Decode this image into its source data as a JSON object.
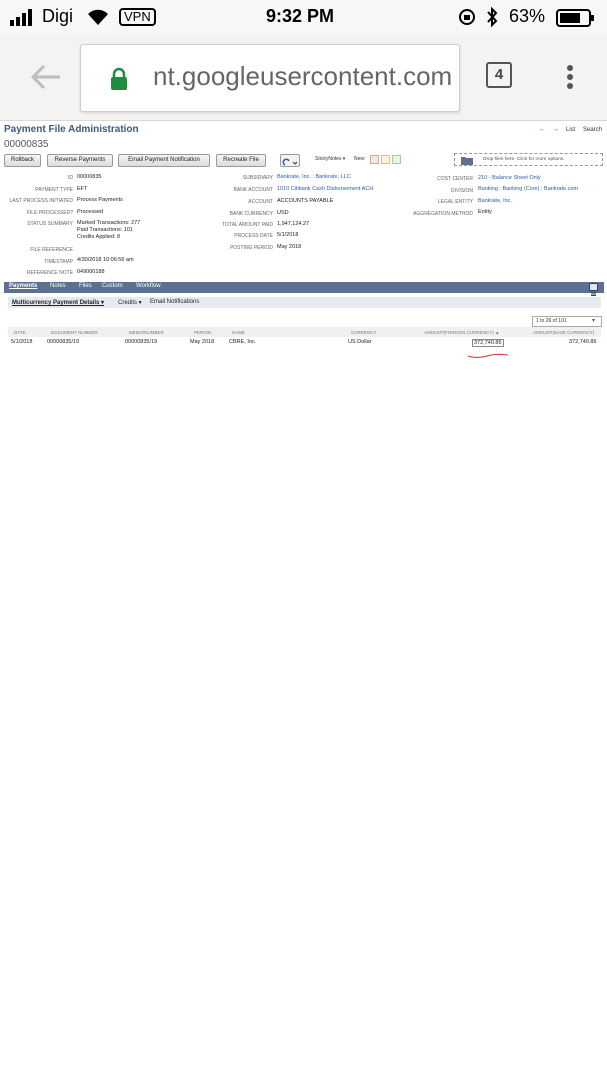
{
  "status_bar": {
    "carrier": "Digi",
    "vpn": "VPN",
    "time": "9:32 PM",
    "battery": "63%"
  },
  "browser": {
    "url": "nt.googleusercontent.com",
    "tab_count": "4"
  },
  "page": {
    "title": "Payment File Administration",
    "record_id": "00000835",
    "nav": {
      "list": "List",
      "search": "Search"
    },
    "buttons": {
      "rollback": "Rollback",
      "reverse": "Reverse Payments",
      "email": "Email Payment Notification",
      "recreate": "Recreate File"
    },
    "sticky_notes": "StickyNotes ▾",
    "new_label": "New:",
    "drop_zone": "Drop files here. Click for more options.",
    "fields_left": [
      {
        "label": "ID",
        "value": "00000835"
      },
      {
        "label": "Payment Type",
        "value": "EFT"
      },
      {
        "label": "Last Process Initiated",
        "value": "Process Payments"
      },
      {
        "label": "File Processed?",
        "value": "Processed"
      },
      {
        "label": "Status Summary",
        "value": "Marked Transactions: 277"
      },
      {
        "label": "File Reference",
        "value": ""
      },
      {
        "label": "Timestamp",
        "value": "4/30/2018 10:06:56 am"
      },
      {
        "label": "Reference Note",
        "value": "049000188"
      }
    ],
    "status_extra": [
      "Paid Transactions: 101",
      "Credits Applied: 8"
    ],
    "fields_mid": [
      {
        "label": "Subsidiary",
        "value": "Bankrate, Inc. : Bankrate, LLC"
      },
      {
        "label": "Bank Account",
        "value": "1010 Citibank Cash Disbursement ACH"
      },
      {
        "label": "Account",
        "value": "ACCOUNTS PAYABLE"
      },
      {
        "label": "Bank Currency",
        "value": "USD"
      },
      {
        "label": "Total Amount Paid",
        "value": "1,947,124.27"
      },
      {
        "label": "Process Date",
        "value": "5/1/2018"
      },
      {
        "label": "Posting Period",
        "value": "May 2018"
      }
    ],
    "fields_right": [
      {
        "label": "Cost Center",
        "value": "210 - Balance Sheet Only"
      },
      {
        "label": "Division",
        "value": "Banking : Banking (Core) : Bankrate.com"
      },
      {
        "label": "Legal Entity",
        "value": "Bankrate, Inc."
      },
      {
        "label": "Aggregation Method",
        "value": "Entity"
      }
    ],
    "tabs": [
      "Payments",
      "Notes",
      "Files",
      "Custom",
      "Workflow"
    ],
    "subtabs": [
      "Multicurrency Payment Details ▾",
      "Credits ▾",
      "Email Notifications"
    ],
    "pager": "1 to 26 of 101",
    "table": {
      "headers": [
        "Date",
        "Document Number",
        "Memo/Number",
        "Period",
        "Name",
        "Currency",
        "Amount(Foreign Currency) ▲",
        "Amount(Base Currency)"
      ],
      "rows": [
        [
          "5/1/2018",
          "00000835/19",
          "00000835/19",
          "May 2018",
          "CBRE, Inc.",
          "US Dollar",
          "372,740.86",
          "372,740.86"
        ]
      ]
    }
  }
}
